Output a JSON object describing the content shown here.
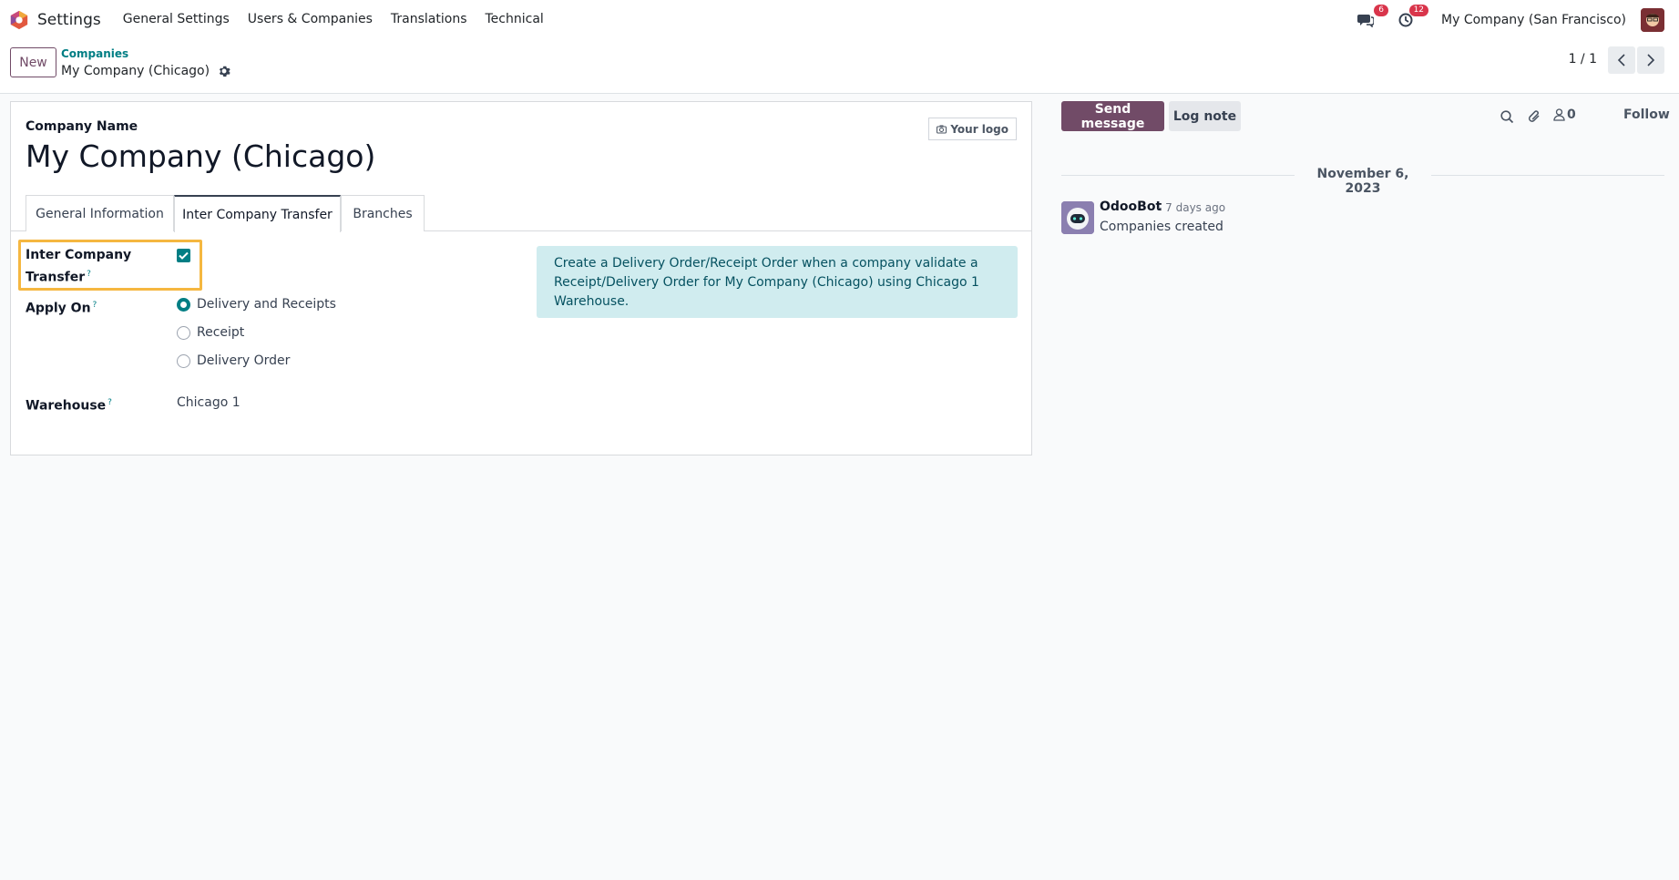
{
  "navbar": {
    "app_name": "Settings",
    "menu": [
      "General Settings",
      "Users & Companies",
      "Translations",
      "Technical"
    ],
    "messages_count": "6",
    "activities_count": "12",
    "company_switcher": "My Company (San Francisco)"
  },
  "control_panel": {
    "new_label": "New",
    "breadcrumb_parent": "Companies",
    "breadcrumb_current": "My Company (Chicago)",
    "pager": "1 / 1"
  },
  "form": {
    "company_name_label": "Company Name",
    "company_name": "My Company (Chicago)",
    "logo_label": "Your logo",
    "tabs": [
      "General Information",
      "Inter Company Transfer",
      "Branches"
    ],
    "active_tab": "Inter Company Transfer",
    "inter_company_label_1": "Inter Company",
    "inter_company_label_2": "Transfer",
    "inter_company_checked": true,
    "apply_on_label": "Apply On",
    "apply_on_options": [
      "Delivery and Receipts",
      "Receipt",
      "Delivery Order"
    ],
    "apply_on_selected": "Delivery and Receipts",
    "warehouse_label": "Warehouse",
    "warehouse_value": "Chicago 1",
    "help_mark": "?",
    "info_text": "Create a Delivery Order/Receipt Order when a company validate a Receipt/Delivery Order for My Company (Chicago) using Chicago 1 Warehouse."
  },
  "chatter": {
    "send_message": "Send message",
    "log_note": "Log note",
    "followers_count": "0",
    "follow": "Follow",
    "date": "November 6, 2023",
    "messages": [
      {
        "author": "OdooBot",
        "time": "- 7 days ago",
        "body": "Companies created"
      }
    ]
  },
  "colors": {
    "brand": "#714b67",
    "accent": "#017e84",
    "highlight": "#f5b740",
    "info_bg": "#d0ecef",
    "badge": "#d9354b"
  }
}
